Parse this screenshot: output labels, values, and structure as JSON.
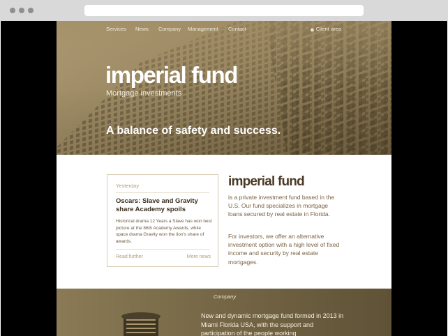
{
  "nav": {
    "items": [
      "Services",
      "News",
      "Company",
      "Management",
      "Contact"
    ],
    "client_area": "Client area"
  },
  "hero": {
    "brand": "imperial fund",
    "subtitle": "Mortgage investments",
    "tagline": "A balance of safety and success."
  },
  "news": {
    "date": "Yesterday",
    "title": "Oscars: Slave and Gravity share Academy spoils",
    "body": "Historical drama 12 Years a Slave has won best picture at the 86th Academy Awards, while space drama Gravity won the lion's share of awards.",
    "read_further": "Read further",
    "more_news": "More news"
  },
  "about": {
    "brand": "imperial fund",
    "paragraph1": "is a private investment fund based in the U.S. Our fund specializes in mortgage loans secured by real estate in Florida.",
    "paragraph2": "For investors, we offer an alternative investment option with a high level of fixed income and security by real estate mortgages."
  },
  "company": {
    "label": "Company",
    "text": "New and dynamic mortgage fund formed in 2013 in Miami Florida USA, with the support and participation of the people working"
  },
  "colors": {
    "hero_tint": "#8f7d57",
    "brand_dark": "#4a3a26",
    "accent_gold": "#b59d70",
    "company_tint": "#6f6140"
  },
  "icons": [
    "lock-icon"
  ]
}
